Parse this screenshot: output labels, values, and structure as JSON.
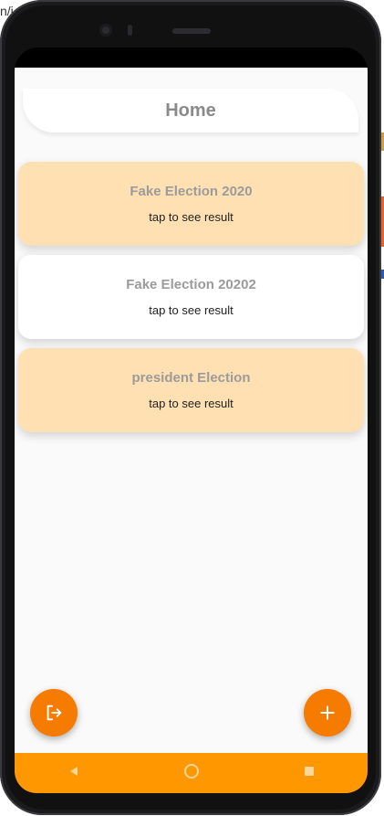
{
  "app": {
    "title": "Home"
  },
  "elections": [
    {
      "name": "Fake Election 2020",
      "subtitle": "tap to see result",
      "background": "#ffe0b2"
    },
    {
      "name": "Fake Election 20202",
      "subtitle": "tap to see result",
      "background": "#ffffff"
    },
    {
      "name": "president Election",
      "subtitle": "tap to see result",
      "background": "#ffe0b2"
    }
  ],
  "fabs": {
    "logout_icon": "logout-icon",
    "add_icon": "plus-icon",
    "color": "#f57c00"
  },
  "nav": {
    "bar_color": "#ff9800",
    "back_icon": "triangle-back-icon",
    "home_icon": "circle-home-icon",
    "recents_icon": "square-recents-icon"
  },
  "backdrop": {
    "url_fragment": "n/i"
  }
}
